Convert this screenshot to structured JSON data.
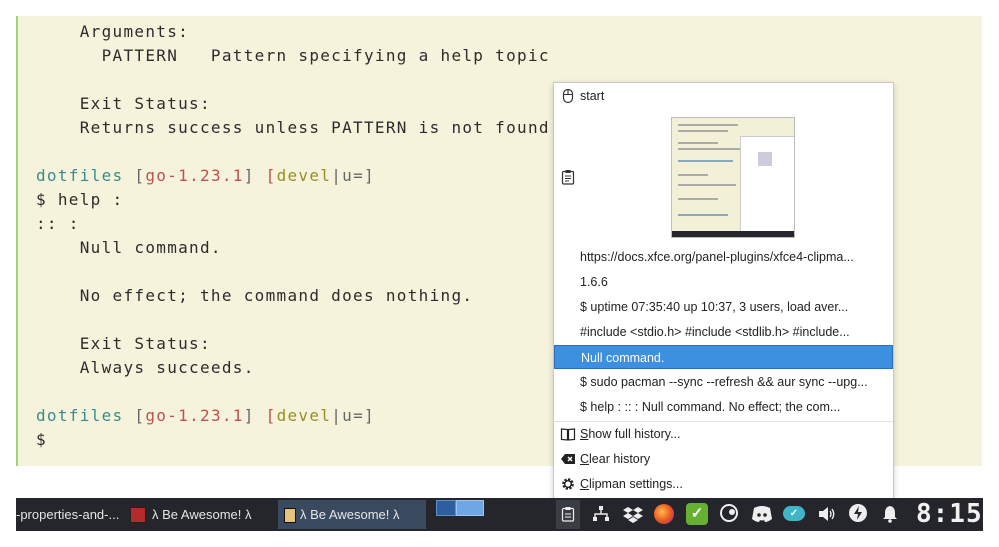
{
  "terminal": {
    "lines": {
      "l1": "    Arguments:",
      "l2": "      PATTERN   Pattern specifying a help topic",
      "l3": "    Exit Status:",
      "l4": "    Returns success unless PATTERN is not found",
      "prompt_dir": "dotfiles",
      "prompt_branch_open": "[",
      "prompt_branch": "go-1.23.1",
      "prompt_branch_close": "]",
      "prompt_git_open": "[",
      "prompt_git": "devel",
      "prompt_git_sep": "|u=]",
      "l6": "$ help :",
      "l7": ":: :",
      "l8": "    Null command.",
      "l9": "    No effect; the command does nothing.",
      "l10": "    Exit Status:",
      "l11": "    Always succeeds.",
      "l13": "$"
    }
  },
  "clipman_menu": {
    "header_label": "start",
    "history": [
      "https://docs.xfce.org/panel-plugins/xfce4-clipma...",
      "1.6.6",
      "$ uptime   07:35:40 up 10:37, 3 users, load aver...",
      "#include <stdio.h> #include <stdlib.h> #include...",
      "Null command.",
      "$ sudo pacman --sync --refresh && aur sync --upg...",
      "$ help : :: :  Null command.  No effect; the com..."
    ],
    "actions": {
      "show_history": "Show full history...",
      "clear_history": "Clear history",
      "settings": "Clipman settings..."
    }
  },
  "taskbar": {
    "tasks": [
      "-properties-and-...",
      "λ Be Awesome! λ",
      "λ Be Awesome! λ"
    ],
    "clock": "8:15"
  },
  "colors": {
    "selection": "#3d8fe0",
    "terminal_bg": "#f6f3dc",
    "taskbar_bg": "#24262b"
  }
}
